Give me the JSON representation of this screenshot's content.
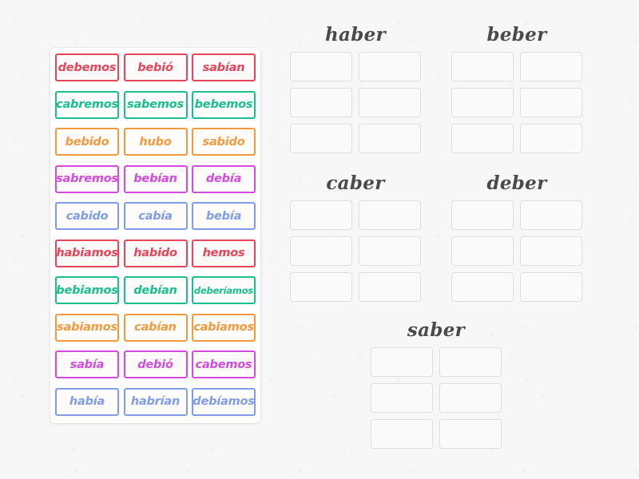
{
  "palette": {
    "red": "#e8445a",
    "green": "#19bf8c",
    "orange": "#f49a3c",
    "magenta": "#d54ae0",
    "blue": "#7f9de8",
    "title_gray": "#4a4a4a",
    "slot_border": "#dcdcdc",
    "page_bg": "#f7f7f7",
    "card_bg": "#ffffff"
  },
  "word_bank": {
    "name": "word-bank",
    "rows": [
      {
        "color_key": "red",
        "tiles": [
          "debemos",
          "bebió",
          "sabían"
        ]
      },
      {
        "color_key": "green",
        "tiles": [
          "cabremos",
          "sabemos",
          "bebemos"
        ]
      },
      {
        "color_key": "orange",
        "tiles": [
          "bebido",
          "hubo",
          "sabido"
        ]
      },
      {
        "color_key": "magenta",
        "tiles": [
          "sabremos",
          "bebían",
          "debía"
        ]
      },
      {
        "color_key": "blue",
        "tiles": [
          "cabido",
          "cabía",
          "bebía"
        ]
      },
      {
        "color_key": "red",
        "tiles": [
          "habiamos",
          "habido",
          "hemos"
        ]
      },
      {
        "color_key": "green",
        "tiles": [
          "bebiamos",
          "debían",
          "deberíamos"
        ]
      },
      {
        "color_key": "orange",
        "tiles": [
          "sabiamos",
          "cabían",
          "cabiamos"
        ]
      },
      {
        "color_key": "magenta",
        "tiles": [
          "sabía",
          "debió",
          "cabemos"
        ]
      },
      {
        "color_key": "blue",
        "tiles": [
          "había",
          "habrían",
          "debíamos"
        ]
      }
    ]
  },
  "categories": [
    {
      "id": "haber",
      "title": "haber",
      "slot_count": 6
    },
    {
      "id": "beber",
      "title": "beber",
      "slot_count": 6
    },
    {
      "id": "caber",
      "title": "caber",
      "slot_count": 6
    },
    {
      "id": "deber",
      "title": "deber",
      "slot_count": 6
    },
    {
      "id": "saber",
      "title": "saber",
      "slot_count": 6
    }
  ]
}
